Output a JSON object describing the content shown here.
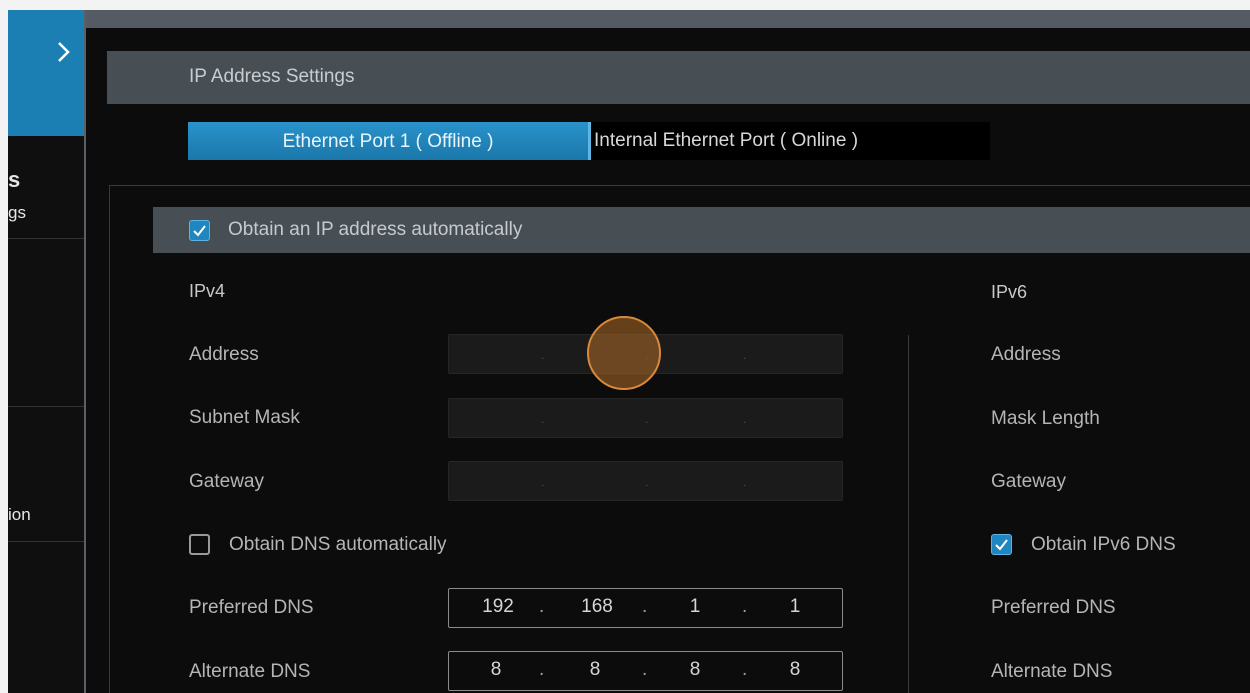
{
  "sidebar": {
    "item1_partial": "s",
    "item1_sub_partial": "gs",
    "item3_partial": "ion"
  },
  "header": {
    "title": "IP Address Settings"
  },
  "tabs": [
    {
      "label": "Ethernet Port 1 ( Offline )",
      "active": true
    },
    {
      "label": "Internal Ethernet Port ( Online )",
      "active": false
    }
  ],
  "auto_ip": {
    "label": "Obtain an IP address automatically",
    "checked": true
  },
  "ipv4": {
    "heading": "IPv4",
    "address_label": "Address",
    "subnet_label": "Subnet Mask",
    "gateway_label": "Gateway",
    "dns_auto": {
      "label": "Obtain DNS automatically",
      "checked": false
    },
    "preferred_dns_label": "Preferred DNS",
    "preferred_dns": [
      "192",
      "168",
      "1",
      "1"
    ],
    "alternate_dns_label": "Alternate DNS",
    "alternate_dns": [
      "8",
      "8",
      "8",
      "8"
    ]
  },
  "ipv6": {
    "heading": "IPv6",
    "address_label": "Address",
    "mask_label": "Mask Length",
    "gateway_label": "Gateway",
    "dns_auto": {
      "label": "Obtain IPv6 DNS",
      "checked": true
    },
    "preferred_dns_label": "Preferred DNS",
    "alternate_dns_label": "Alternate DNS"
  },
  "ip_separator": ".",
  "colors": {
    "accent": "#1f86c0",
    "header_bar": "#474f55",
    "background": "#0c0c0d",
    "cursor": "#d8893b"
  }
}
